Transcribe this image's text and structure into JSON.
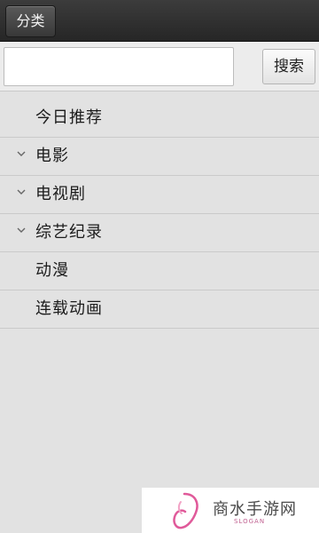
{
  "topbar": {
    "category_label": "分类"
  },
  "search": {
    "value": "",
    "placeholder": "",
    "button_label": "搜索"
  },
  "menu": {
    "items": [
      {
        "label": "今日推荐",
        "has_chevron": false,
        "icon": ""
      },
      {
        "label": "电影",
        "has_chevron": true,
        "icon": "chevron-down-icon"
      },
      {
        "label": "电视剧",
        "has_chevron": true,
        "icon": "chevron-down-icon"
      },
      {
        "label": "综艺纪录",
        "has_chevron": true,
        "icon": "chevron-down-icon"
      },
      {
        "label": "动漫",
        "has_chevron": false,
        "icon": ""
      },
      {
        "label": "连载动画",
        "has_chevron": false,
        "icon": ""
      }
    ]
  },
  "watermark": {
    "text": "商水手游网",
    "slogan": "SLOGAN",
    "icon": "brand-logo-icon",
    "accent_color": "#e05a9a"
  },
  "colors": {
    "topbar": "#2f2f2f",
    "background": "#e2e2e2",
    "divider": "#cacaca"
  }
}
